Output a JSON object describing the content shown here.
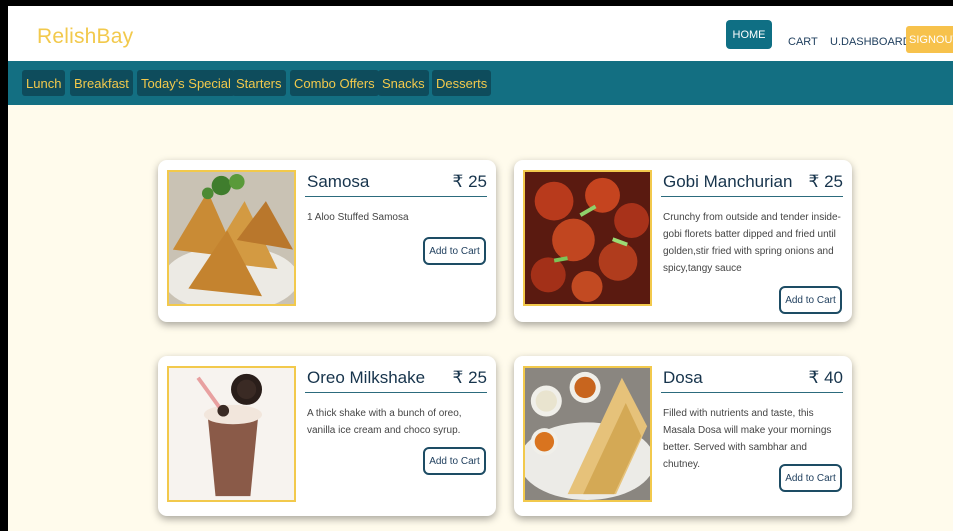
{
  "brand": "RelishBay",
  "nav": {
    "home": "HOME",
    "cart": "CART",
    "dashboard": "U.DASHBOARD",
    "signout": "SIGNOUT"
  },
  "categories": [
    "Lunch",
    "Breakfast",
    "Today's Special",
    "Starters",
    "Combo Offers",
    "Snacks",
    "Desserts"
  ],
  "currency_symbol": "₹",
  "items": [
    {
      "name": "Samosa",
      "price": "₹ 25",
      "description": "1 Aloo Stuffed Samosa",
      "button": "Add to Cart",
      "image_icon": "samosa-photo"
    },
    {
      "name": "Gobi Manchurian",
      "price": "₹ 25",
      "description": "Crunchy from outside and tender inside-gobi florets batter dipped and fried until golden,stir fried with spring onions and spicy,tangy sauce",
      "button": "Add to Cart",
      "image_icon": "gobi-manchurian-photo"
    },
    {
      "name": "Oreo Milkshake",
      "price": "₹ 25",
      "description": "A thick shake with a bunch of oreo, vanilla ice cream and choco syrup.",
      "button": "Add to Cart",
      "image_icon": "oreo-milkshake-photo"
    },
    {
      "name": "Dosa",
      "price": "₹ 40",
      "description": "Filled with nutrients and taste, this Masala Dosa will make your mornings better. Served with sambhar and chutney.",
      "button": "Add to Cart",
      "image_icon": "dosa-photo"
    }
  ],
  "colors": {
    "accent": "#136f82",
    "brand": "#f2c94c",
    "page_background": "#fffbec",
    "category_chip": "#0e4c5c"
  }
}
